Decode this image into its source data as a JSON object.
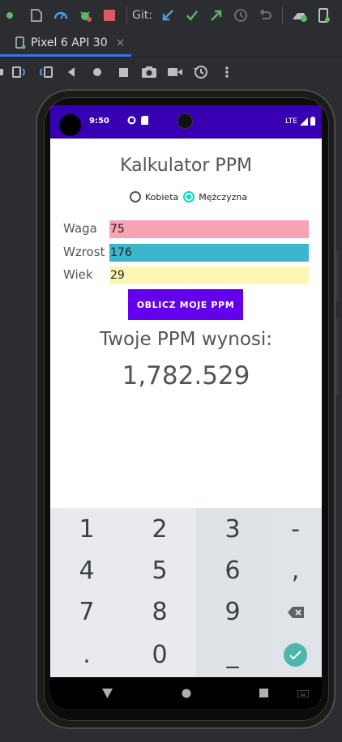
{
  "ide": {
    "git_label": "Git:",
    "tab_label": "Pixel 6 API 30",
    "tab_close": "×"
  },
  "phone": {
    "status": {
      "time": "9:50",
      "network": "LTE"
    },
    "app": {
      "title": "Kalkulator PPM",
      "gender": {
        "option_female": "Kobieta",
        "option_male": "Mężczyzna",
        "selected": "Mężczyzna"
      },
      "fields": [
        {
          "label": "Waga",
          "value": "75",
          "color": "#f8a3b4"
        },
        {
          "label": "Wzrost",
          "value": "176",
          "color": "#3cb6cc"
        },
        {
          "label": "Wiek",
          "value": "29",
          "color": "#fbf7b2"
        }
      ],
      "button_label": "OBLICZ MOJE PPM",
      "result_label": "Twoje PPM wynosi:",
      "result_value": "1,782.529"
    },
    "keyboard": {
      "keys": [
        "1",
        "2",
        "3",
        "-",
        "4",
        "5",
        "6",
        ",",
        "7",
        "8",
        "9",
        "backspace",
        ".",
        "0",
        "_",
        "done"
      ]
    }
  },
  "colors": {
    "accent": "#6200ee",
    "status_bar": "#3700b3",
    "radio": "#03dac5"
  }
}
